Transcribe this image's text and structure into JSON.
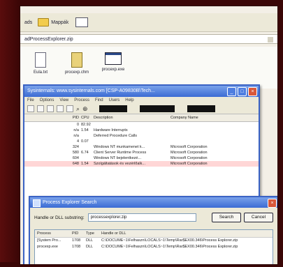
{
  "explorer": {
    "toolbar_tail": "ads",
    "folders_label": "Mappák",
    "address": "adProcessExplorer.zip",
    "files": [
      {
        "label": "Eula.txt",
        "icon": "text-file-icon"
      },
      {
        "label": "procexp.chm",
        "icon": "help-file-icon"
      },
      {
        "label": "procexp.exe",
        "icon": "app-window-icon"
      }
    ]
  },
  "process_explorer": {
    "title": "Sysinternals: www.sysinternals.com [CSP-A09830B\\Tech...",
    "menu": [
      "File",
      "Options",
      "View",
      "Process",
      "Find",
      "Users",
      "Help"
    ],
    "columns": [
      "PID",
      "CPU",
      "Description",
      "Company Name"
    ],
    "rows": [
      {
        "pid": "0",
        "cpu": "82.92",
        "desc": "",
        "company": ""
      },
      {
        "pid": "n/a",
        "cpu": "1.54",
        "desc": "Hardware Interrupts",
        "company": ""
      },
      {
        "pid": "n/a",
        "cpu": "",
        "desc": "Deferred Procedure Calls",
        "company": ""
      },
      {
        "pid": "4",
        "cpu": "0.07",
        "desc": "",
        "company": ""
      },
      {
        "pid": "324",
        "cpu": "",
        "desc": "Windows NT munkamenet k...",
        "company": "Microsoft Corporation"
      },
      {
        "pid": "580",
        "cpu": "6.74",
        "desc": "Client Server Runtime Process",
        "company": "Microsoft Corporation"
      },
      {
        "pid": "604",
        "cpu": "",
        "desc": "Windows NT bejelentkezé...",
        "company": "Microsoft Corporation"
      },
      {
        "pid": "648",
        "cpu": "1.54",
        "desc": "Szolgáltatások és vezérlőalk...",
        "company": "Microsoft Corporation"
      }
    ]
  },
  "search_dialog": {
    "title": "Process Explorer Search",
    "label": "Handle or DLL substring:",
    "query": "processexplorer.zip",
    "search_btn": "Search",
    "cancel_btn": "Cancel",
    "columns": [
      "Process",
      "PID",
      "Type",
      "Handle or DLL"
    ],
    "results": [
      {
        "process": "[System Pro...",
        "pid": "1708",
        "type": "DLL",
        "handle": "C:\\DOCUME~1\\Felhaszn\\LOCALS~1\\Temp\\Rar$EX00.346\\Process Explorer.zip"
      },
      {
        "process": "procexp.exe",
        "pid": "1708",
        "type": "DLL",
        "handle": "C:\\DOCUME~1\\Felhaszn\\LOCALS~1\\Temp\\Rar$EX00.346\\Process Explorer.zip"
      }
    ]
  }
}
